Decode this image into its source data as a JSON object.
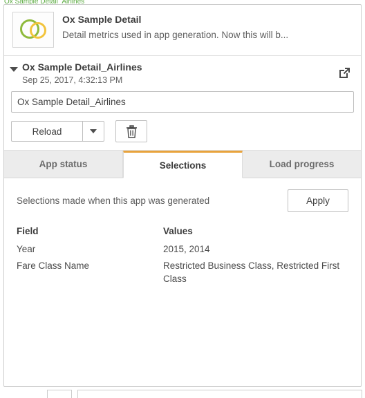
{
  "window": {
    "top_strip_text": "Ox Sample Detail_Airlines"
  },
  "app": {
    "title": "Ox Sample Detail",
    "description": "Detail metrics used in app generation. Now this will b...",
    "thumbnail_icon": "two-circles-icon"
  },
  "task": {
    "expander_icon": "caret-down-icon",
    "name": "Ox Sample Detail_Airlines",
    "timestamp": "Sep 25, 2017, 4:32:13 PM",
    "open_icon": "open-external-icon"
  },
  "name_field": {
    "value": "Ox Sample Detail_Airlines",
    "placeholder": "Ox Sample Detail_Airlines"
  },
  "toolbar": {
    "reload_label": "Reload",
    "dropdown_icon": "caret-down-icon",
    "delete_icon": "trash-icon"
  },
  "tabs": [
    {
      "label": "App status",
      "active": false
    },
    {
      "label": "Selections",
      "active": true
    },
    {
      "label": "Load progress",
      "active": false
    }
  ],
  "selections": {
    "note": "Selections made when this app was generated",
    "apply_label": "Apply",
    "columns": [
      "Field",
      "Values"
    ],
    "rows": [
      {
        "field": "Year",
        "values": "2015, 2014"
      },
      {
        "field": "Fare Class Name",
        "values": "Restricted Business Class, Restricted First Class"
      }
    ]
  },
  "colors": {
    "accent": "#e8a33d",
    "thumb_green": "#8fba3c",
    "thumb_yellow": "#f2c43d",
    "border": "#cccccc",
    "top_strip": "#5aaa3f"
  }
}
